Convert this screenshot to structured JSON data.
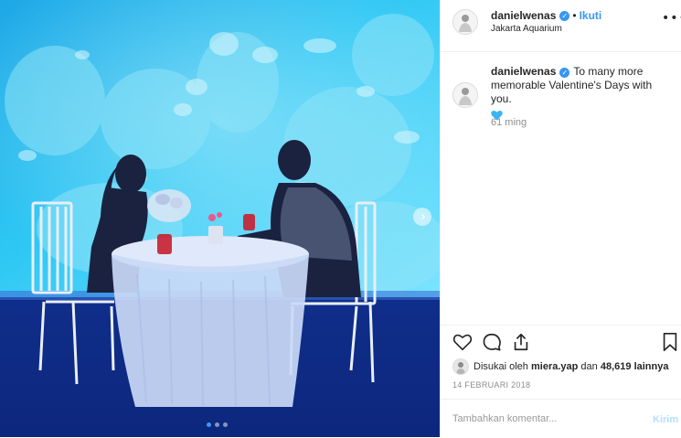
{
  "post": {
    "username": "danielwenas",
    "verified_icon": "verified-badge-icon",
    "follow_separator": "•",
    "follow_label": "Ikuti",
    "location": "Jakarta Aquarium",
    "more_icon": "more-options-icon",
    "more_glyph": "•••",
    "caption": {
      "username": "danielwenas",
      "text": "To many more memorable Valentine's Days with you.",
      "emoji": "blue-heart-emoji"
    },
    "time_ago": "61 ming",
    "likes": {
      "prefix": "Disukai oleh",
      "user": "miera.yap",
      "connector": "dan",
      "count": "48,619",
      "suffix": "lainnya"
    },
    "date": "14 FEBRUARI 2018",
    "comment": {
      "placeholder": "Tambahkan komentar...",
      "post_label": "Kirim"
    },
    "carousel": {
      "slides": 3,
      "current": 1,
      "next_glyph": "›"
    }
  },
  "colors": {
    "link_blue": "#3897f0",
    "post_disabled": "#b2dffc",
    "secondary_text": "#8e8e8e",
    "aquarium_cyan": "#29c3f2",
    "floor_blue": "#0c2d86"
  }
}
